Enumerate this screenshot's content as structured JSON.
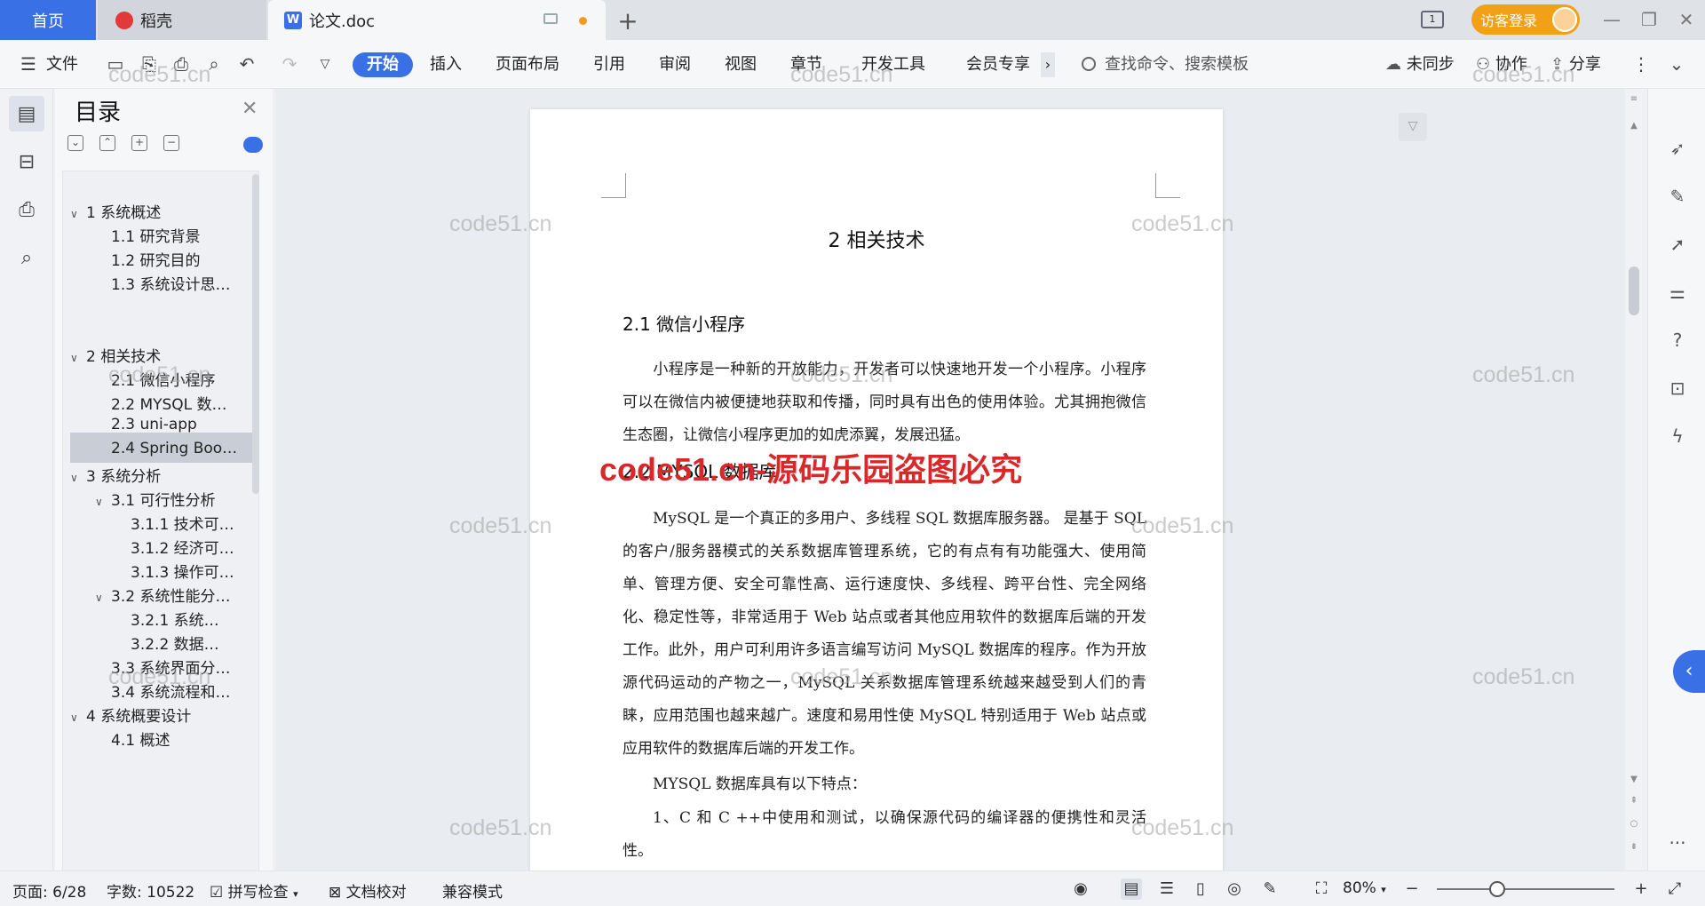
{
  "titlebar": {
    "home_tab": "首页",
    "app_tab": "稻壳",
    "doc_tab": "论文.doc",
    "add_tab": "+",
    "window_num": "1",
    "login": "访客登录"
  },
  "ribbon": {
    "file": "文件",
    "tabs": [
      "开始",
      "插入",
      "页面布局",
      "引用",
      "审阅",
      "视图",
      "章节",
      "开发工具",
      "会员专享"
    ],
    "more": "›",
    "search_placeholder": "查找命令、搜索模板",
    "sync": "未同步",
    "collab": "协作",
    "share": "分享"
  },
  "toc": {
    "title": "目录",
    "items": [
      {
        "label": "1 系统概述",
        "level": 1,
        "caret": "∨"
      },
      {
        "label": "1.1 研究背景",
        "level": 2
      },
      {
        "label": "1.2 研究目的",
        "level": 2
      },
      {
        "label": "1.3 系统设计思…",
        "level": 2
      },
      {
        "label": "2 相关技术",
        "level": 1,
        "caret": "∨"
      },
      {
        "label": "2.1 微信小程序",
        "level": 2
      },
      {
        "label": "2.2 MYSQL 数…",
        "level": 2
      },
      {
        "label": "2.3 uni-app",
        "level": 2
      },
      {
        "label": "2.4 Spring Boo…",
        "level": 2
      },
      {
        "label": "3 系统分析",
        "level": 1,
        "caret": "∨"
      },
      {
        "label": "3.1 可行性分析",
        "level": 2,
        "caret": "∨"
      },
      {
        "label": "3.1.1 技术可…",
        "level": 3
      },
      {
        "label": "3.1.2 经济可…",
        "level": 3
      },
      {
        "label": "3.1.3 操作可…",
        "level": 3
      },
      {
        "label": "3.2 系统性能分…",
        "level": 2,
        "caret": "∨"
      },
      {
        "label": "3.2.1  系统…",
        "level": 3
      },
      {
        "label": "3.2.2  数据…",
        "level": 3
      },
      {
        "label": "3.3 系统界面分…",
        "level": 2
      },
      {
        "label": "3.4 系统流程和…",
        "level": 2
      },
      {
        "label": "4 系统概要设计",
        "level": 1,
        "caret": "∨"
      },
      {
        "label": "4.1 概述",
        "level": 2
      }
    ]
  },
  "document": {
    "chapter_title": "2 相关技术",
    "section1_title": "2.1 微信小程序",
    "section1_para": "小程序是一种新的开放能力，开发者可以快速地开发一个小程序。小程序可以在微信内被便捷地获取和传播，同时具有出色的使用体验。尤其拥抱微信生态圈，让微信小程序更加的如虎添翼，发展迅猛。",
    "section2_title": "2.2 MYSQL 数据库",
    "section2_para": "MySQL 是一个真正的多用户、多线程 SQL 数据库服务器。 是基于 SQL 的客户/服务器模式的关系数据库管理系统，它的有点有有功能强大、使用简单、管理方便、安全可靠性高、运行速度快、多线程、跨平台性、完全网络化、稳定性等，非常适用于 Web 站点或者其他应用软件的数据库后端的开发工作。此外，用户可利用许多语言编写访问 MySQL 数据库的程序。作为开放源代码运动的产物之一，MySQL 关系数据库管理系统越来越受到人们的青睐，应用范围也越来越广。速度和易用性使 MySQL 特别适用于 Web 站点或应用软件的数据库后端的开发工作。",
    "features_intro": "MYSQL 数据库具有以下特点：",
    "feature1": "1、C 和 C ++中使用和测试，以确保源代码的编译器的便携性和灵活性。"
  },
  "watermarks": {
    "small": "code51.cn",
    "big": "code51.cn-源码乐园盗图必究"
  },
  "status": {
    "page": "页面: 6/28",
    "words": "字数: 10522",
    "spell": "拼写检查",
    "proof": "文档校对",
    "compat": "兼容模式",
    "zoom": "80%",
    "zoom_level": 0.8
  },
  "colors": {
    "accent": "#3a70e6",
    "login": "#f3a019",
    "watermark_red": "#d8282a"
  }
}
